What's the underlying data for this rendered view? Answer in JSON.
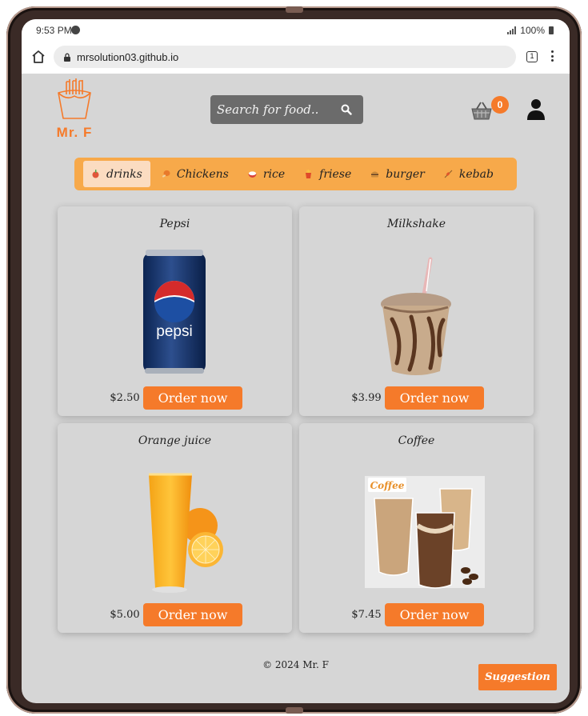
{
  "status_bar": {
    "time": "9:53 PM",
    "battery": "100%"
  },
  "browser": {
    "url": "mrsolution03.github.io",
    "tab_count": "1"
  },
  "header": {
    "logo_text": "Mr. F",
    "search_placeholder": "Search for food..",
    "cart_count": "0"
  },
  "categories": [
    {
      "label": "drinks",
      "active": true
    },
    {
      "label": "Chickens",
      "active": false
    },
    {
      "label": "rice",
      "active": false
    },
    {
      "label": "friese",
      "active": false
    },
    {
      "label": "burger",
      "active": false
    },
    {
      "label": "kebab",
      "active": false
    }
  ],
  "products": [
    {
      "name": "Pepsi",
      "price": "$2.50",
      "button": "Order now"
    },
    {
      "name": "Milkshake",
      "price": "$3.99",
      "button": "Order now"
    },
    {
      "name": "Orange juice",
      "price": "$5.00",
      "button": "Order now"
    },
    {
      "name": "Coffee",
      "price": "$7.45",
      "button": "Order now"
    }
  ],
  "footer": {
    "copyright": "© 2024 Mr. F"
  },
  "suggestion": {
    "label": "Suggestion"
  },
  "colors": {
    "accent": "#f57a2a",
    "category_bar": "#f7a94a",
    "page_bg": "#d6d6d6"
  }
}
